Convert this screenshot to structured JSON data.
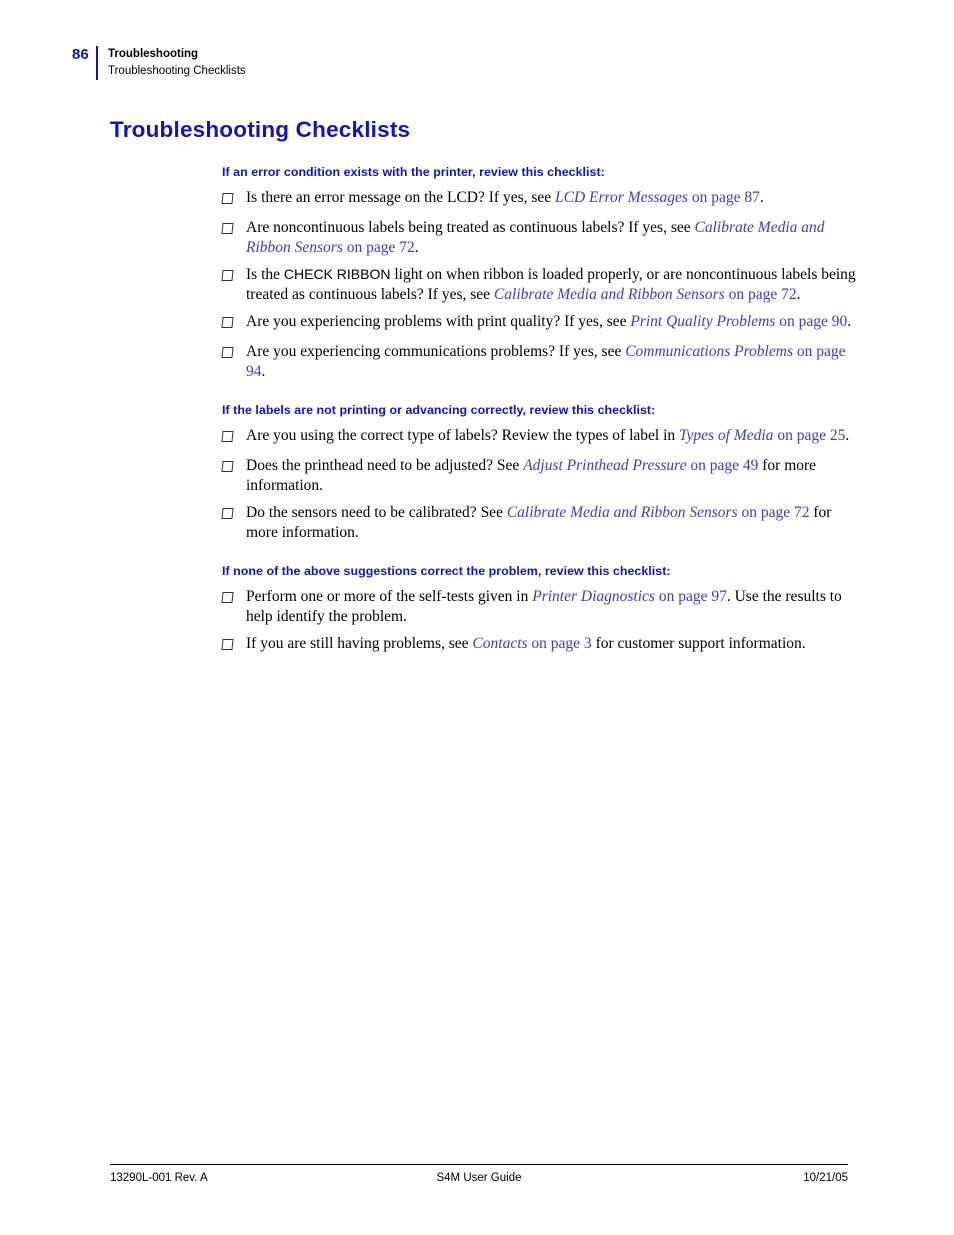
{
  "header": {
    "page_number": "86",
    "chapter": "Troubleshooting",
    "section": "Troubleshooting Checklists",
    "accent_color": "#1414b4"
  },
  "title": "Troubleshooting Checklists",
  "sections": [
    {
      "heading": "If an error condition exists with the printer, review this checklist:",
      "items": [
        {
          "parts": [
            {
              "t": "Is there an error message on the LCD? If yes, see ",
              "s": "plain"
            },
            {
              "t": "LCD Error Messages",
              "s": "link"
            },
            {
              "t": " ",
              "s": "plain"
            },
            {
              "t": "on page 87",
              "s": "link-plain"
            },
            {
              "t": ".",
              "s": "plain"
            }
          ]
        },
        {
          "parts": [
            {
              "t": "Are noncontinuous labels being treated as continuous labels? If yes, see ",
              "s": "plain"
            },
            {
              "t": "Calibrate Media and Ribbon Sensors",
              "s": "link"
            },
            {
              "t": " ",
              "s": "plain"
            },
            {
              "t": "on page 72",
              "s": "link-plain"
            },
            {
              "t": ".",
              "s": "plain"
            }
          ]
        },
        {
          "parts": [
            {
              "t": "Is the ",
              "s": "plain"
            },
            {
              "t": "CHECK RIBBON",
              "s": "sans"
            },
            {
              "t": " light on when ribbon is loaded properly, or are noncontinuous labels being treated as continuous labels? If yes, see ",
              "s": "plain"
            },
            {
              "t": "Calibrate Media and Ribbon Sensors",
              "s": "link"
            },
            {
              "t": " ",
              "s": "plain"
            },
            {
              "t": "on page 72",
              "s": "link-plain"
            },
            {
              "t": ".",
              "s": "plain"
            }
          ]
        },
        {
          "parts": [
            {
              "t": "Are you experiencing problems with print quality? If yes, see ",
              "s": "plain"
            },
            {
              "t": "Print Quality Problems",
              "s": "link"
            },
            {
              "t": " ",
              "s": "plain"
            },
            {
              "t": "on page 90",
              "s": "link-plain"
            },
            {
              "t": ".",
              "s": "plain"
            }
          ]
        },
        {
          "parts": [
            {
              "t": "Are you experiencing communications problems? If yes, see ",
              "s": "plain"
            },
            {
              "t": "Communications Problems",
              "s": "link"
            },
            {
              "t": " ",
              "s": "plain"
            },
            {
              "t": "on page 94",
              "s": "link-plain"
            },
            {
              "t": ".",
              "s": "plain"
            }
          ]
        }
      ]
    },
    {
      "heading": "If the labels are not printing or advancing correctly, review this checklist:",
      "items": [
        {
          "parts": [
            {
              "t": "Are you using the correct type of labels? Review the types of label in ",
              "s": "plain"
            },
            {
              "t": "Types of Media",
              "s": "link"
            },
            {
              "t": " ",
              "s": "plain"
            },
            {
              "t": "on page 25",
              "s": "link-plain"
            },
            {
              "t": ".",
              "s": "plain"
            }
          ]
        },
        {
          "parts": [
            {
              "t": "Does the printhead need to be adjusted? See ",
              "s": "plain"
            },
            {
              "t": "Adjust Printhead Pressure",
              "s": "link"
            },
            {
              "t": " ",
              "s": "plain"
            },
            {
              "t": "on page 49",
              "s": "link-plain"
            },
            {
              "t": " for more information.",
              "s": "plain"
            }
          ]
        },
        {
          "parts": [
            {
              "t": "Do the sensors need to be calibrated? See ",
              "s": "plain"
            },
            {
              "t": "Calibrate Media and Ribbon Sensors",
              "s": "link"
            },
            {
              "t": " ",
              "s": "plain"
            },
            {
              "t": "on page 72",
              "s": "link-plain"
            },
            {
              "t": " for more information.",
              "s": "plain"
            }
          ]
        }
      ]
    },
    {
      "heading": "If none of the above suggestions correct the problem, review this checklist:",
      "items": [
        {
          "parts": [
            {
              "t": "Perform one or more of the self-tests given in ",
              "s": "plain"
            },
            {
              "t": "Printer Diagnostics",
              "s": "link"
            },
            {
              "t": " ",
              "s": "plain"
            },
            {
              "t": "on page 97",
              "s": "link-plain"
            },
            {
              "t": ". Use the results to help identify the problem.",
              "s": "plain"
            }
          ]
        },
        {
          "parts": [
            {
              "t": "If you are still having problems, see ",
              "s": "plain"
            },
            {
              "t": "Contacts",
              "s": "link"
            },
            {
              "t": " ",
              "s": "plain"
            },
            {
              "t": "on page 3",
              "s": "link-plain"
            },
            {
              "t": " for customer support information.",
              "s": "plain"
            }
          ]
        }
      ]
    }
  ],
  "footer": {
    "left": "13290L-001 Rev. A",
    "center": "S4M User Guide",
    "right": "10/21/05"
  },
  "bullet_glyph": "checkbox-square"
}
